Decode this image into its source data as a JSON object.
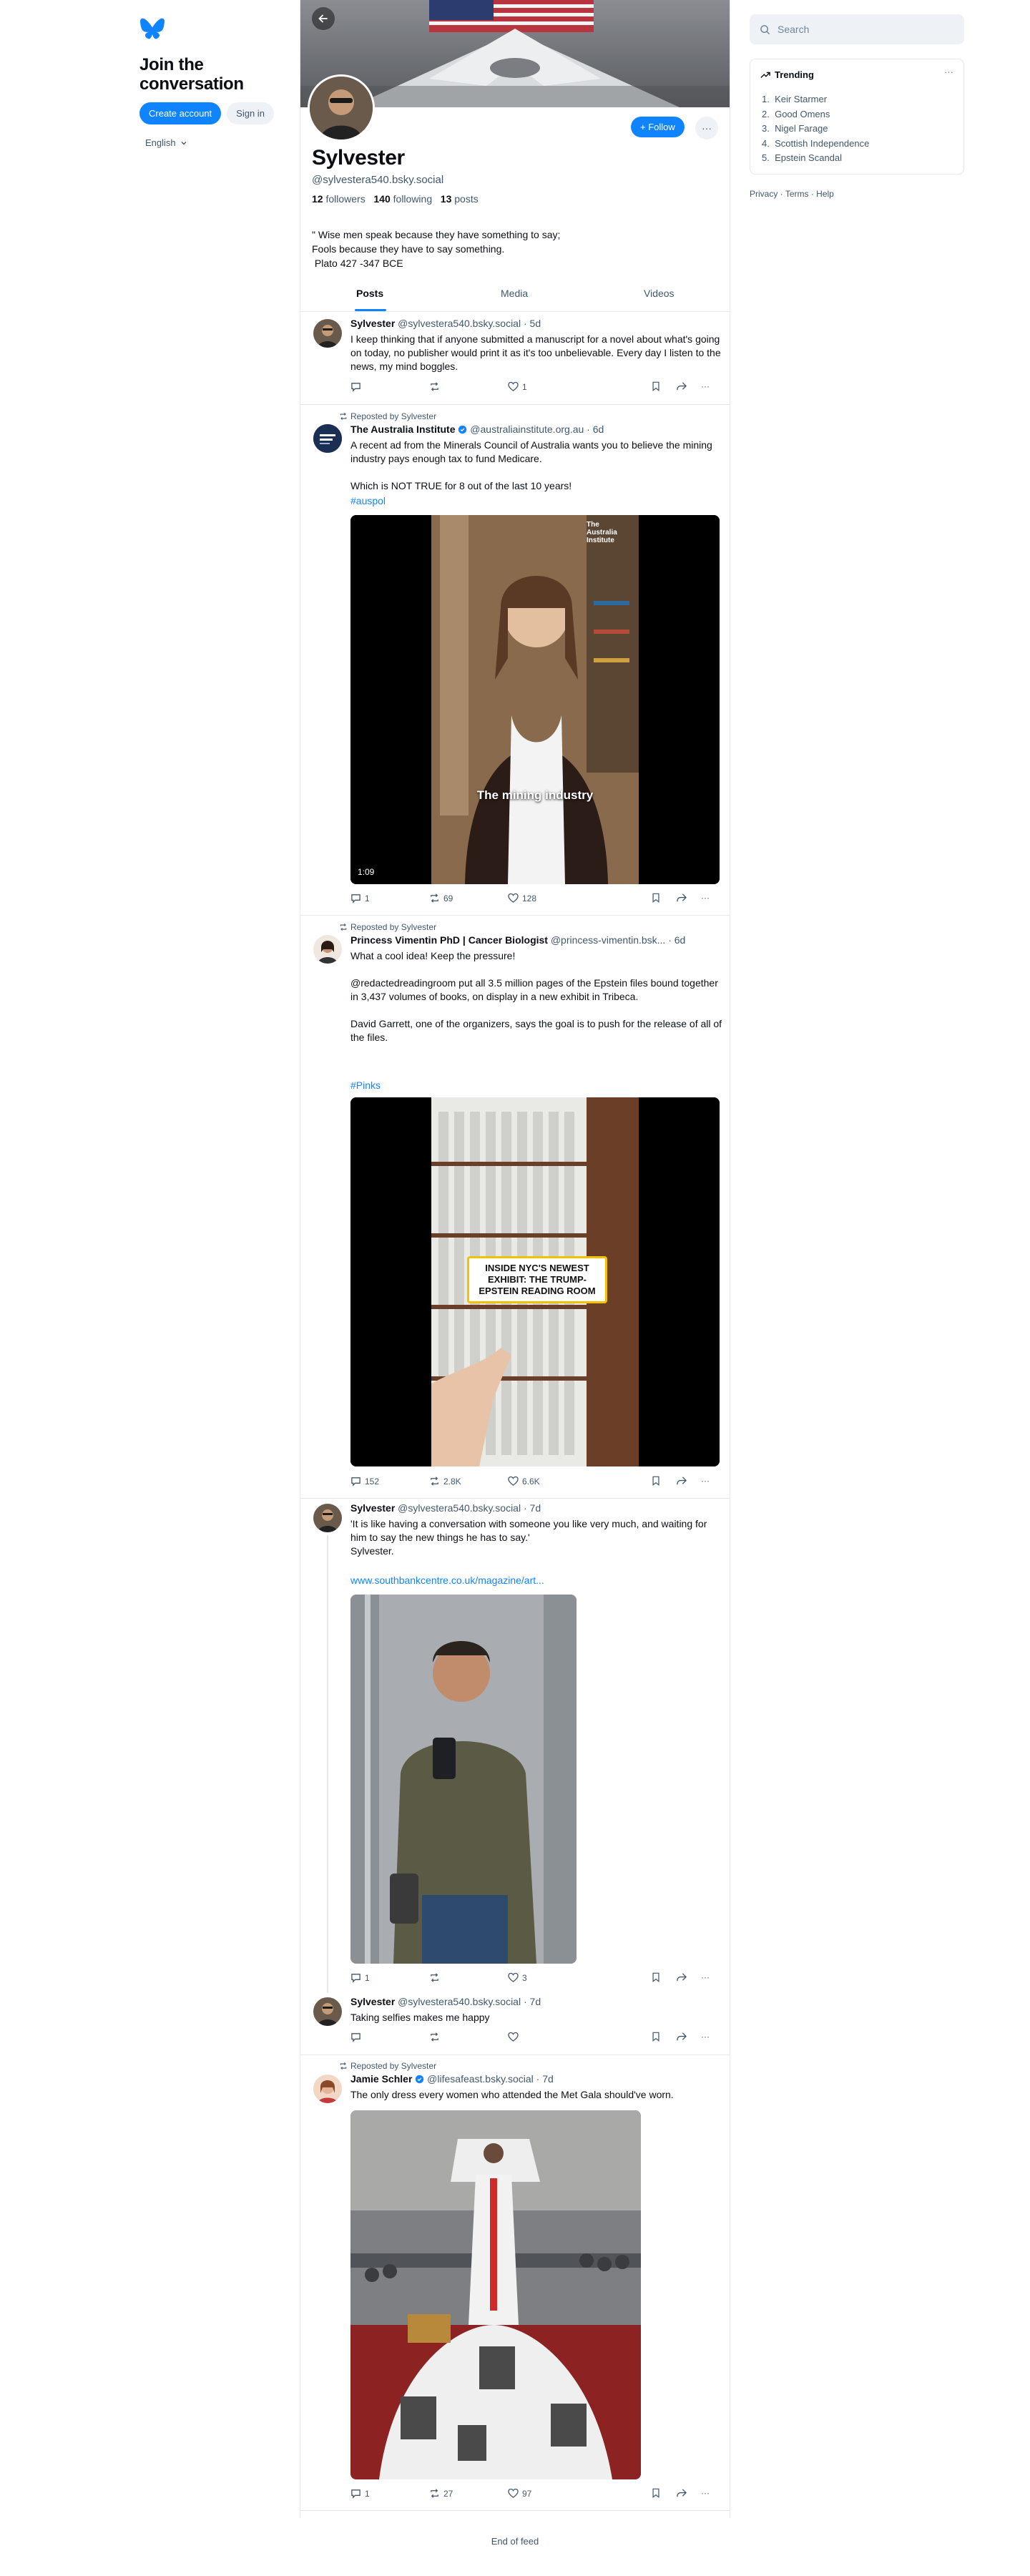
{
  "left": {
    "join_title": "Join the conversation",
    "create_account": "Create account",
    "sign_in": "Sign in",
    "language": "English"
  },
  "profile": {
    "name": "Sylvester",
    "handle": "@sylvestera540.bsky.social",
    "followers_count": "12",
    "followers_label": "followers",
    "following_count": "140",
    "following_label": "following",
    "posts_count": "13",
    "posts_label": "posts",
    "bio": "\" Wise men speak because they have something to say;\nFools because they have to say something.\n Plato 427 -347 BCE",
    "follow_label": "+ Follow",
    "tabs": [
      "Posts",
      "Media",
      "Videos"
    ]
  },
  "posts": [
    {
      "author": "Sylvester",
      "handle": "@sylvestera540.bsky.social",
      "time": "· 5d",
      "text": "I keep thinking that if anyone submitted a manuscript for a novel about what's going on today, no publisher would print it as it's too unbelievable. Every day I listen to the news, my mind boggles.",
      "replies": "",
      "reposts": "",
      "likes": "1"
    },
    {
      "reposted_by": "Reposted by Sylvester",
      "author": "The Australia Institute",
      "handle": "@australiainstitute.org.au",
      "time": "· 6d",
      "text": "A recent ad from the Minerals Council of Australia wants you to believe the mining industry pays enough tax to fund Medicare.\n\nWhich is NOT TRUE for 8 out of the last 10 years!",
      "hashtag": "#auspol",
      "video_caption": "The mining industry",
      "video_watermark": "The Australia Institute",
      "video_time": "1:09",
      "replies": "1",
      "reposts": "69",
      "likes": "128"
    },
    {
      "reposted_by": "Reposted by Sylvester",
      "author": "Princess Vimentin PhD | Cancer Biologist",
      "handle": "@princess-vimentin.bsk...",
      "time": "· 6d",
      "text": "What a cool idea! Keep the pressure!\n\n@redactedreadingroom put all 3.5 million pages of the Epstein files bound together in 3,437 volumes of books, on display in a new exhibit in Tribeca.\n\nDavid Garrett, one of the organizers, says the goal is to push for the release of all of the files.",
      "hashtag": "#Pinks",
      "video_caption": "INSIDE NYC'S NEWEST EXHIBIT: THE TRUMP-EPSTEIN READING ROOM",
      "replies": "152",
      "reposts": "2.8K",
      "likes": "6.6K"
    },
    {
      "author": "Sylvester",
      "handle": "@sylvestera540.bsky.social",
      "time": "· 7d",
      "text": "'It is like having a conversation with someone you like very much, and waiting for him to say the new things he has to say.'\nSylvester.",
      "link": "www.southbankcentre.co.uk/magazine/art...",
      "replies": "1",
      "reposts": "",
      "likes": "3"
    },
    {
      "author": "Sylvester",
      "handle": "@sylvestera540.bsky.social",
      "time": "· 7d",
      "text": "Taking selfies makes me happy",
      "replies": "",
      "reposts": "",
      "likes": ""
    },
    {
      "reposted_by": "Reposted by Sylvester",
      "author": "Jamie Schler",
      "handle": "@lifesafeast.bsky.social",
      "time": "· 7d",
      "text": "The only dress every women who attended the Met Gala should've worn.",
      "replies": "1",
      "reposts": "27",
      "likes": "97"
    }
  ],
  "end_of_feed": "End of feed",
  "search": {
    "placeholder": "Search"
  },
  "trending": {
    "title": "Trending",
    "items": [
      {
        "rank": "1.",
        "label": "Keir Starmer"
      },
      {
        "rank": "2.",
        "label": "Good Omens"
      },
      {
        "rank": "3.",
        "label": "Nigel Farage"
      },
      {
        "rank": "4.",
        "label": "Scottish Independence"
      },
      {
        "rank": "5.",
        "label": "Epstein Scandal"
      }
    ]
  },
  "footer": {
    "privacy": "Privacy",
    "terms": "Terms",
    "help": "Help",
    "dot": "·"
  },
  "colors": {
    "accent": "#1083fe",
    "text": "#0b0f14",
    "muted": "#42576c",
    "border": "#e4e8ec"
  },
  "icons": [
    "butterfly-logo-icon",
    "arrow-left-icon",
    "ellipsis-icon",
    "reply-icon",
    "repost-icon",
    "heart-icon",
    "bookmark-icon",
    "share-icon",
    "search-icon",
    "trending-icon",
    "verified-icon",
    "chevron-down-icon"
  ]
}
